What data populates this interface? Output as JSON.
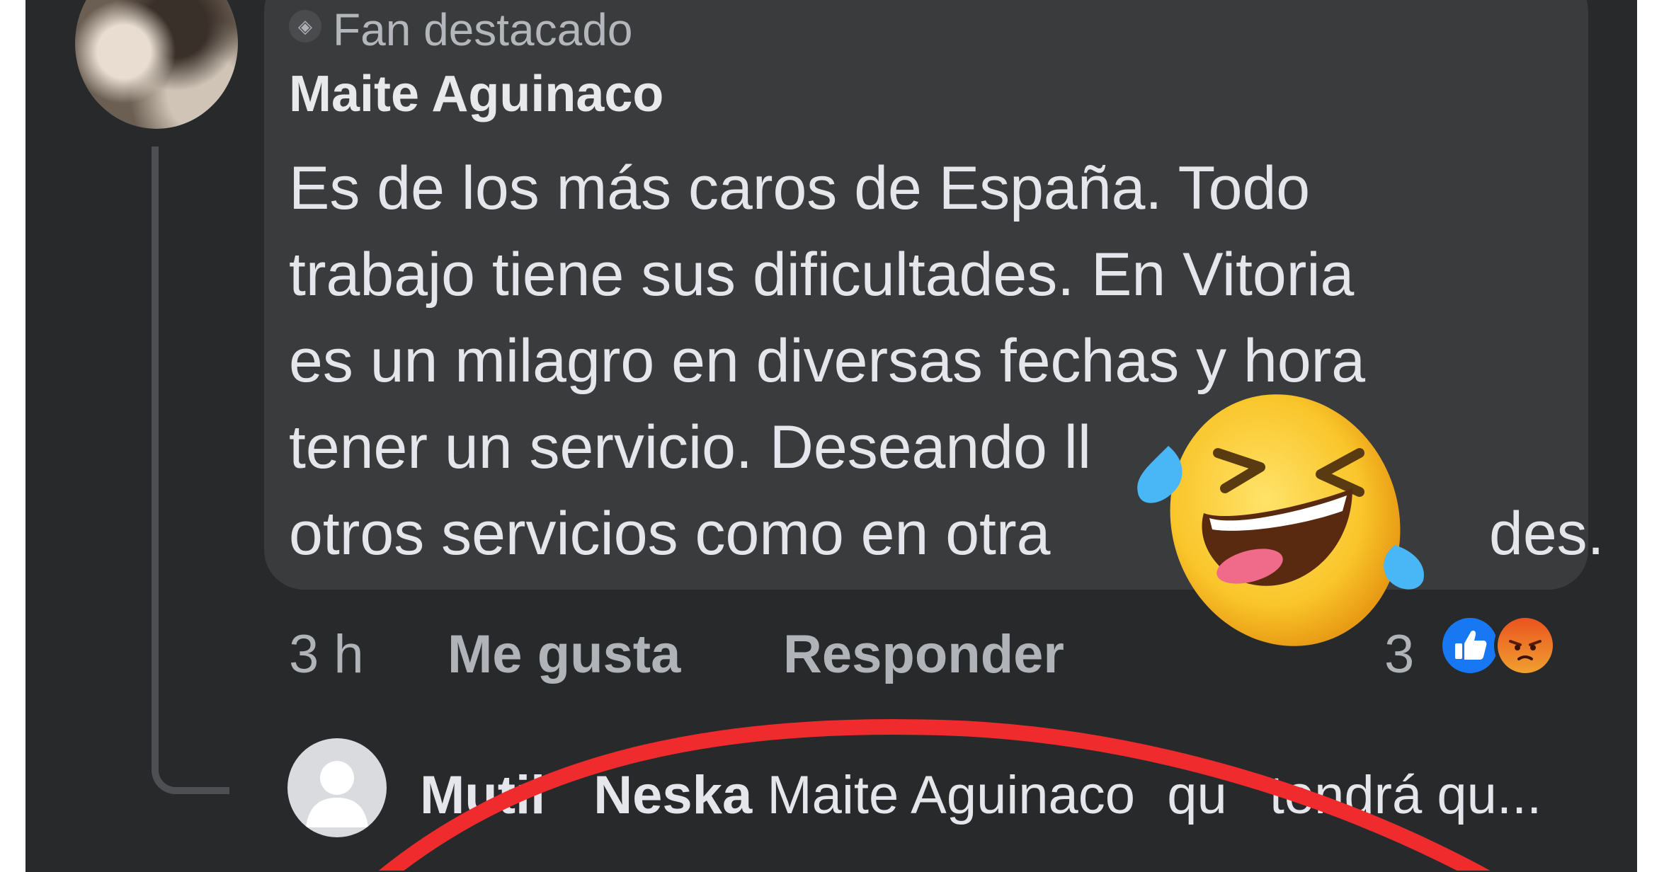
{
  "comment": {
    "badge_icon": "diamond-icon",
    "badge_label": "Fan destacado",
    "author": "Maite Aguinaco",
    "lines": [
      "Es de los más caros de España. Todo",
      "trabajo tiene sus dificultades. En Vitoria",
      "es un milagro  en diversas fechas y hora",
      "tener un servicio. Deseando ll",
      "otros servicios como en otra"
    ],
    "line_tails": [
      "",
      "",
      "",
      "",
      "des."
    ],
    "time": "3 h",
    "like_label": "Me gusta",
    "reply_label": "Responder",
    "reaction_count": "3",
    "reactions": [
      "like-icon",
      "angry-icon"
    ]
  },
  "reply": {
    "name_a": "Mutil",
    "name_b": "Neska",
    "text_a": "Maite Aguinaco",
    "text_b": "qu",
    "text_c": "tendrá qu..."
  },
  "overlays": {
    "emoji": "laughing-crying-emoji",
    "marker_color": "#ef2b2d"
  },
  "colors": {
    "background": "#27292b",
    "bubble": "#3a3b3c",
    "like_blue": "#1877f2"
  }
}
